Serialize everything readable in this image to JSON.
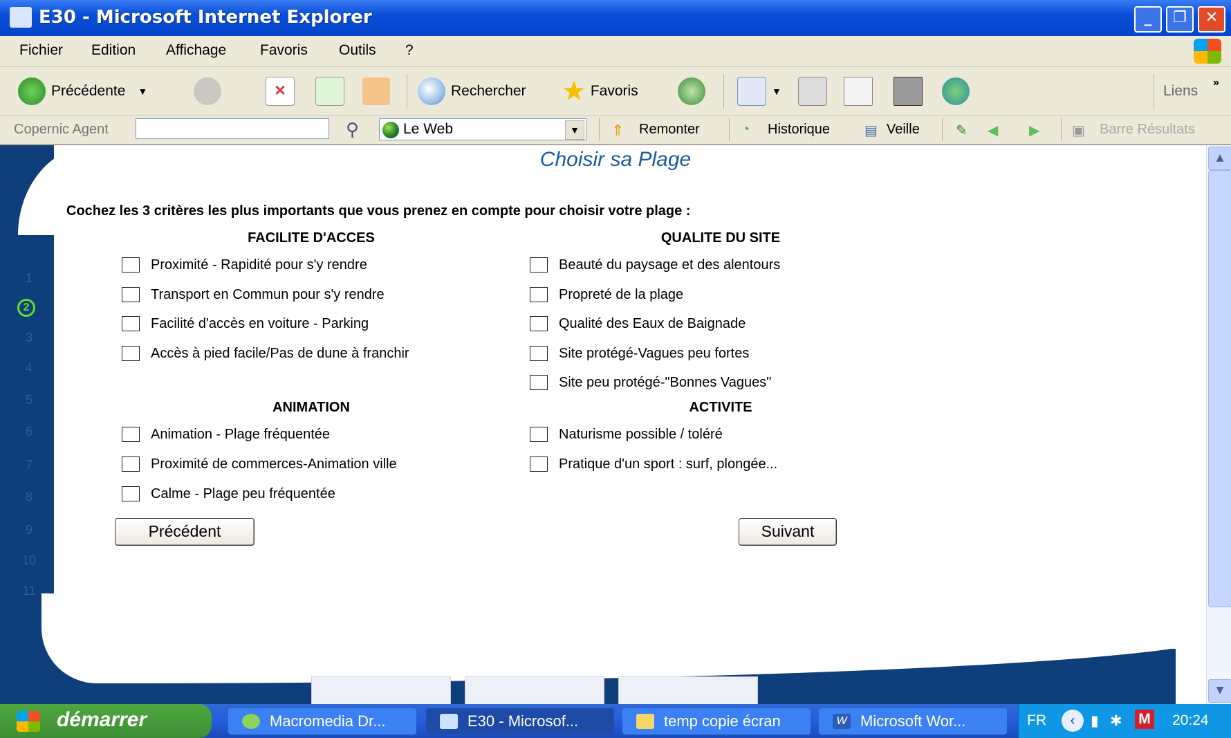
{
  "window": {
    "title": "E30 - Microsoft Internet Explorer"
  },
  "menu": [
    "Fichier",
    "Edition",
    "Affichage",
    "Favoris",
    "Outils",
    "?"
  ],
  "toolbar": {
    "back_label": "Précédente",
    "search_label": "Rechercher",
    "favorites_label": "Favoris",
    "links_label": "Liens"
  },
  "copernic": {
    "agent_label": "Copernic Agent",
    "input_value": "",
    "scope_value": "Le Web",
    "up_label": "Remonter",
    "history_label": "Historique",
    "watch_label": "Veille",
    "results_label": "Barre Résultats"
  },
  "steps": [
    "1",
    "2",
    "3",
    "4",
    "5",
    "6",
    "7",
    "8",
    "9",
    "10",
    "11"
  ],
  "active_step": "2",
  "page": {
    "title": "Choisir sa Plage",
    "instruction": "Cochez les 3 critères les plus importants que vous prenez en compte pour choisir votre plage :",
    "sections": {
      "access": {
        "title": "FACILITE D'ACCES",
        "options": [
          "Proximité - Rapidité pour s'y rendre",
          "Transport en Commun pour s'y rendre",
          "Facilité d'accès en voiture - Parking",
          "Accès à pied facile/Pas de dune à franchir"
        ]
      },
      "quality": {
        "title": "QUALITE DU SITE",
        "options": [
          "Beauté du paysage et des alentours",
          "Propreté de la plage",
          "Qualité des Eaux de Baignade",
          "Site protégé-Vagues peu fortes",
          "Site peu protégé-\"Bonnes Vagues\""
        ]
      },
      "animation": {
        "title": "ANIMATION",
        "options": [
          "Animation - Plage fréquentée",
          "Proximité de commerces-Animation ville",
          "Calme - Plage peu fréquentée"
        ]
      },
      "activity": {
        "title": "ACTIVITE",
        "options": [
          "Naturisme possible / toléré",
          "Pratique d'un sport : surf, plongée..."
        ]
      }
    },
    "prev_button": "Précédent",
    "next_button": "Suivant"
  },
  "taskbar": {
    "start_label": "démarrer",
    "tasks": [
      "Macromedia Dr...",
      "E30 - Microsof...",
      "temp copie écran",
      "Microsoft Wor..."
    ],
    "lang": "FR",
    "clock": "20:24"
  },
  "colors": {
    "titlebar": "#0a4fd8",
    "accent": "#1b5aa3",
    "band": "#0f3f7a",
    "active_step": "#5fdc2e"
  }
}
